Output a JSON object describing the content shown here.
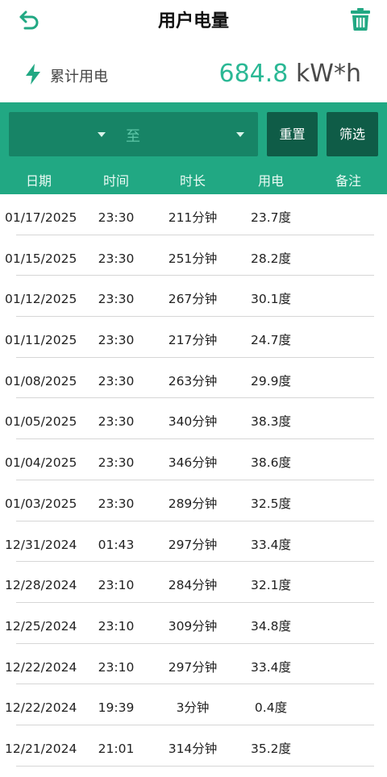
{
  "header": {
    "title": "用户电量",
    "back_icon": "back-arrow-icon",
    "delete_icon": "trash-icon"
  },
  "summary": {
    "label": "累计用电",
    "value": "684.8",
    "unit": "kW*h",
    "icon": "lightning-bolt-icon"
  },
  "filter": {
    "start_date": "",
    "separator": "至",
    "end_date": "",
    "reset_label": "重置",
    "filter_label": "筛选"
  },
  "columns": [
    "日期",
    "时间",
    "时长",
    "用电",
    "备注"
  ],
  "records": [
    {
      "date": "01/17/2025",
      "time": "23:30",
      "duration": "211分钟",
      "usage": "23.7度",
      "note": ""
    },
    {
      "date": "01/15/2025",
      "time": "23:30",
      "duration": "251分钟",
      "usage": "28.2度",
      "note": ""
    },
    {
      "date": "01/12/2025",
      "time": "23:30",
      "duration": "267分钟",
      "usage": "30.1度",
      "note": ""
    },
    {
      "date": "01/11/2025",
      "time": "23:30",
      "duration": "217分钟",
      "usage": "24.7度",
      "note": ""
    },
    {
      "date": "01/08/2025",
      "time": "23:30",
      "duration": "263分钟",
      "usage": "29.9度",
      "note": ""
    },
    {
      "date": "01/05/2025",
      "time": "23:30",
      "duration": "340分钟",
      "usage": "38.3度",
      "note": ""
    },
    {
      "date": "01/04/2025",
      "time": "23:30",
      "duration": "346分钟",
      "usage": "38.6度",
      "note": ""
    },
    {
      "date": "01/03/2025",
      "time": "23:30",
      "duration": "289分钟",
      "usage": "32.5度",
      "note": ""
    },
    {
      "date": "12/31/2024",
      "time": "01:43",
      "duration": "297分钟",
      "usage": "33.4度",
      "note": ""
    },
    {
      "date": "12/28/2024",
      "time": "23:10",
      "duration": "284分钟",
      "usage": "32.1度",
      "note": ""
    },
    {
      "date": "12/25/2024",
      "time": "23:10",
      "duration": "309分钟",
      "usage": "34.8度",
      "note": ""
    },
    {
      "date": "12/22/2024",
      "time": "23:10",
      "duration": "297分钟",
      "usage": "33.4度",
      "note": ""
    },
    {
      "date": "12/22/2024",
      "time": "19:39",
      "duration": "3分钟",
      "usage": "0.4度",
      "note": ""
    },
    {
      "date": "12/21/2024",
      "time": "21:01",
      "duration": "314分钟",
      "usage": "35.2度",
      "note": ""
    }
  ],
  "colors": {
    "accent": "#21a883",
    "accent_dark": "#178466",
    "button": "#0f5c47",
    "value_text": "#2bb895"
  }
}
